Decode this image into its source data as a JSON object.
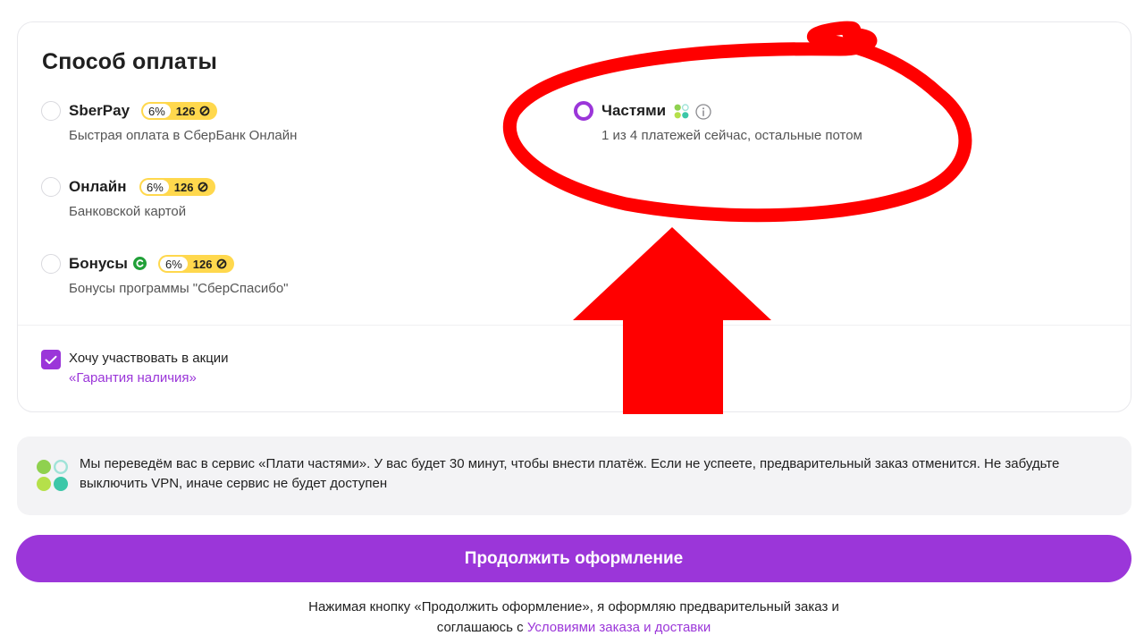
{
  "payment": {
    "title": "Способ оплаты",
    "options": [
      {
        "name": "SberPay",
        "desc": "Быстрая оплата в СберБанк Онлайн",
        "badge_pct": "6%",
        "badge_points": "126",
        "selected": false
      },
      {
        "name": "Онлайн",
        "desc": "Банковской картой",
        "badge_pct": "6%",
        "badge_points": "126",
        "selected": false
      },
      {
        "name": "Бонусы",
        "desc": "Бонусы программы \"СберСпасибо\"",
        "badge_pct": "6%",
        "badge_points": "126",
        "selected": false
      },
      {
        "name": "Частями",
        "desc": "1 из 4 платежей сейчас, остальные потом",
        "selected": true
      }
    ],
    "promo_checkbox": {
      "label": "Хочу участвовать в акции",
      "link": "«Гарантия наличия»",
      "checked": true
    }
  },
  "info": {
    "text": "Мы переведём вас в сервис «Плати частями». У вас будет 30 минут, чтобы внести платёж. Если не успеете, предварительный заказ отменится. Не забудьте выключить VPN, иначе сервис не будет доступен"
  },
  "continue_button": "Продолжить оформление",
  "footer": {
    "line1": "Нажимая кнопку «Продолжить оформление», я оформляю предварительный заказ и",
    "line2_prefix": "соглашаюсь с ",
    "line2_link": "Условиями заказа и доставки"
  },
  "colors": {
    "accent": "#9b36d9",
    "badge": "#ffd84d",
    "annotation": "#ff0000",
    "sber_green": "#21a038"
  },
  "icons": [
    "coin-icon",
    "sberspasibo-icon",
    "installments-dots-icon",
    "info-icon",
    "checkmark-icon"
  ]
}
